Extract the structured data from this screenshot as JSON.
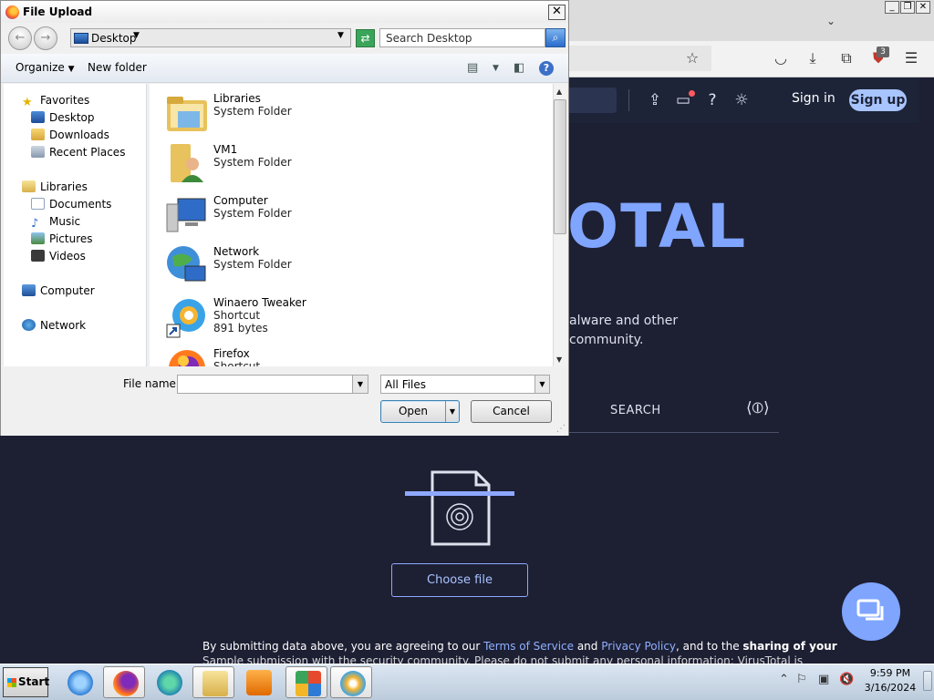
{
  "dialog": {
    "title": "File Upload",
    "close_label": "✕",
    "address": "Desktop",
    "search_placeholder": "Search Desktop",
    "toolbar": {
      "organize": "Organize",
      "new_folder": "New folder",
      "help": "?"
    },
    "nav": {
      "favorites": "Favorites",
      "desktop": "Desktop",
      "downloads": "Downloads",
      "recent": "Recent Places",
      "libraries": "Libraries",
      "documents": "Documents",
      "music": "Music",
      "pictures": "Pictures",
      "videos": "Videos",
      "computer": "Computer",
      "network": "Network"
    },
    "files": [
      {
        "name": "Libraries",
        "type": "System Folder"
      },
      {
        "name": "VM1",
        "type": "System Folder"
      },
      {
        "name": "Computer",
        "type": "System Folder"
      },
      {
        "name": "Network",
        "type": "System Folder"
      },
      {
        "name": "Winaero Tweaker",
        "type": "Shortcut",
        "size": "891 bytes"
      },
      {
        "name": "Firefox",
        "type": "Shortcut"
      }
    ],
    "file_name_label": "File name:",
    "file_name_value": "",
    "filter": "All Files",
    "open_label": "Open",
    "cancel_label": "Cancel"
  },
  "browser": {
    "extension_badge": "3",
    "sign_in": "Sign in",
    "sign_up": "Sign up",
    "logo_fragment": "OTAL",
    "desc_line1": "alware and other",
    "desc_line2": "community.",
    "search_tab": "SEARCH",
    "choose_file": "Choose file",
    "terms_prefix": "By submitting data above, you are agreeing to our ",
    "terms_of_service": "Terms of Service",
    "terms_and": " and ",
    "privacy_policy": "Privacy Policy",
    "terms_suffix": ", and to the ",
    "terms_bold": "sharing of your",
    "terms_line2": "Sample submission with the security community. Please do not submit any personal information; VirusTotal is"
  },
  "taskbar": {
    "start": "Start",
    "time": "9:59 PM",
    "date": "3/16/2024"
  },
  "colors": {
    "accent": "#7fa5ff",
    "page_bg": "#1d1f33",
    "dialog_bg": "#f0f0f0"
  }
}
